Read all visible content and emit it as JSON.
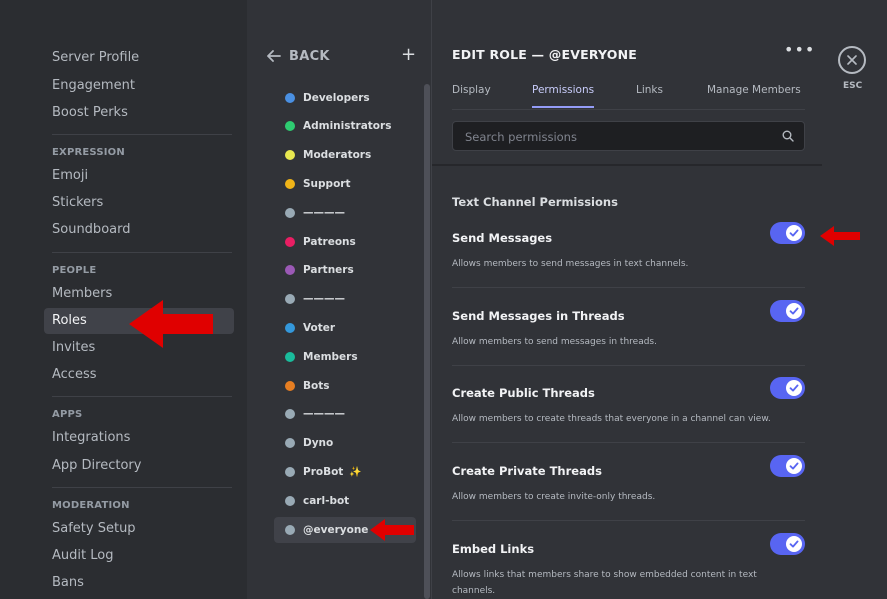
{
  "sidebar": {
    "items": [
      "Server Profile",
      "Engagement",
      "Boost Perks"
    ],
    "expression_header": "EXPRESSION",
    "expression_items": [
      "Emoji",
      "Stickers",
      "Soundboard"
    ],
    "people_header": "PEOPLE",
    "people_items": [
      "Members",
      "Roles",
      "Invites",
      "Access"
    ],
    "apps_header": "APPS",
    "apps_items": [
      "Integrations",
      "App Directory"
    ],
    "moderation_header": "MODERATION",
    "moderation_items": [
      "Safety Setup",
      "Audit Log",
      "Bans"
    ]
  },
  "roles_panel": {
    "back_label": "BACK",
    "add_icon": "plus-icon",
    "roles": [
      {
        "label": "Developers",
        "color": "#4a90e2"
      },
      {
        "label": "Administrators",
        "color": "#2ecc71"
      },
      {
        "label": "Moderators",
        "color": "#e8e850"
      },
      {
        "label": "Support",
        "color": "#f0b418"
      },
      {
        "label": "————",
        "color": "#99aab5"
      },
      {
        "label": "Patreons",
        "color": "#e91e63"
      },
      {
        "label": "Partners",
        "color": "#9b59b6"
      },
      {
        "label": "————",
        "color": "#99aab5"
      },
      {
        "label": "Voter",
        "color": "#3498db"
      },
      {
        "label": "Members",
        "color": "#1abc9c"
      },
      {
        "label": "Bots",
        "color": "#e67e22"
      },
      {
        "label": "————",
        "color": "#99aab5"
      },
      {
        "label": "Dyno",
        "color": "#99aab5"
      },
      {
        "label": "ProBot",
        "color": "#99aab5"
      },
      {
        "label": "carl-bot",
        "color": "#99aab5"
      },
      {
        "label": "@everyone",
        "color": "#99aab5"
      }
    ]
  },
  "main": {
    "title": "EDIT ROLE — @EVERYONE",
    "tabs": [
      "Display",
      "Permissions",
      "Links",
      "Manage Members"
    ],
    "search_placeholder": "Search permissions",
    "section_title": "Text Channel Permissions",
    "permissions": [
      {
        "name": "Send Messages",
        "desc": "Allows members to send messages in text channels.",
        "enabled": true
      },
      {
        "name": "Send Messages in Threads",
        "desc": "Allow members to send messages in threads.",
        "enabled": true
      },
      {
        "name": "Create Public Threads",
        "desc": "Allow members to create threads that everyone in a channel can view.",
        "enabled": true
      },
      {
        "name": "Create Private Threads",
        "desc": "Allow members to create invite-only threads.",
        "enabled": true
      },
      {
        "name": "Embed Links",
        "desc": "Allows links that members share to show embedded content in text channels.",
        "enabled": true
      }
    ]
  },
  "close": {
    "label": "ESC"
  },
  "colors": {
    "accent": "#5865f2",
    "annotation": "#e00000"
  }
}
